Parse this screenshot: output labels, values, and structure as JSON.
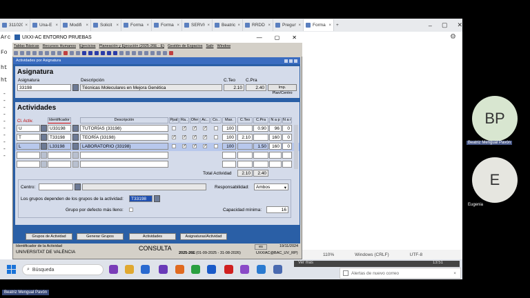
{
  "browser": {
    "tabs": [
      "311020",
      "Una-E",
      "Modifi",
      "Solicit",
      "Forma",
      "Forma",
      "SERVIC",
      "Beatric",
      "RRDD",
      "Pregun",
      "Forma"
    ],
    "active_tab": "Forma",
    "gutter_text": [
      "Arc",
      "Fo",
      "ht",
      "ht",
      "-",
      "-",
      "-",
      "-",
      "-",
      "-",
      "-",
      "-",
      "-",
      "-"
    ]
  },
  "app": {
    "title": "UXXI-AC ENTORNO PRUEBAS",
    "menu": [
      "Tablas Básicas",
      "Recursos Humanos",
      "Ejercicios",
      "Planeación y Ejecución  (2025-26E - E)",
      "Gestión de Espacios",
      "Salir",
      "Window"
    ]
  },
  "form": {
    "title": "Actividades por Asignatura",
    "asignatura": {
      "heading": "Asignatura",
      "label_asig": "Asignatura",
      "label_desc": "Descripción",
      "label_cteo": "C.Teo",
      "label_cpra": "C.Pra",
      "code": "33198",
      "description": "Técnicas Moleculares en Mejora Genética",
      "cteo": "2.10",
      "cpra": "2.40",
      "btn_plan": "Imp. Plan/Centro"
    },
    "actividades": {
      "heading": "Actividades",
      "col_cl": "Cl. Activ.",
      "col_id": "Identificador",
      "col_desc": "Descripción",
      "col_ppal": "Ppal",
      "col_ra": "Ra..",
      "col_ofer": "Ofer",
      "col_ac": "Ac..",
      "col_co": "Co..",
      "col_max": "Max.",
      "col_cteo": "C.Teo",
      "col_cpra": "C.Pra",
      "col_nap": "N a p",
      "col_nar": "N a r",
      "rows": [
        {
          "cl": "U",
          "id": "U33198",
          "desc": "TUTORÍAS (33198)",
          "ppal": "",
          "ra": "✓",
          "ofer": "✓",
          "ac": "✓",
          "max": "100",
          "cteo": "",
          "cpra": "0.90",
          "nap": "96",
          "nar": "0"
        },
        {
          "cl": "T",
          "id": "T33198",
          "desc": "TEORÍA (33198)",
          "ppal": "✓",
          "ra": "✓",
          "ofer": "✓",
          "ac": "✓",
          "max": "100",
          "cteo": "2.10",
          "cpra": "",
          "nap": "160",
          "nar": "0"
        },
        {
          "cl": "L",
          "id": "L33198",
          "desc": "LABORATORIO (33198)",
          "ppal": "",
          "ra": "✓",
          "ofer": "✓",
          "ac": "✓",
          "max": "100",
          "cteo": "",
          "cpra": "1.50",
          "nap": "160",
          "nar": "0"
        }
      ],
      "total_label": "Total Actividad",
      "total_cteo": "2.10",
      "total_cpra": "2.40"
    },
    "detalle": {
      "centro_label": "Centro:",
      "responsabilidad_label": "Responsabilidad:",
      "responsabilidad_value": "Ambos",
      "depend_label": "Los grupos dependen de los grupos de la actividad:",
      "depend_value": "T33198",
      "grupo_label": "Grupo por defecto más lleno:",
      "capacidad_label": "Capacidad mínima:",
      "capacidad_value": "16"
    },
    "buttons": [
      "Grupos de Actividad",
      "Generar Grupos",
      "Actividades",
      "Asignaturas/Actividad"
    ]
  },
  "status": {
    "id_label": "Identificador de la Actividad",
    "org": "UNIVERSITAT DE VALÈNCIA",
    "mode": "CONSULTA",
    "period": "2025-26E",
    "dates": "(01-09-2025 - 31-08-2026)",
    "es": "es",
    "date": "19/11/2024",
    "server": "UXXIAC@BAC_UV_RP)"
  },
  "editor_status": {
    "zoom": "110%",
    "eol": "Windows (CRLF)",
    "enc": "UTF-8"
  },
  "taskbar": {
    "search": "Búsqueda",
    "vermas": "Ver más",
    "toast": "Alertas de nuevo correo",
    "time": "13:51"
  },
  "participants": [
    {
      "initials": "BP",
      "name": "Beatriz Mengual Pavón"
    },
    {
      "initials": "E",
      "name": "Eugenia"
    }
  ],
  "bottom_name": "Beatriz Mengual Pavón"
}
